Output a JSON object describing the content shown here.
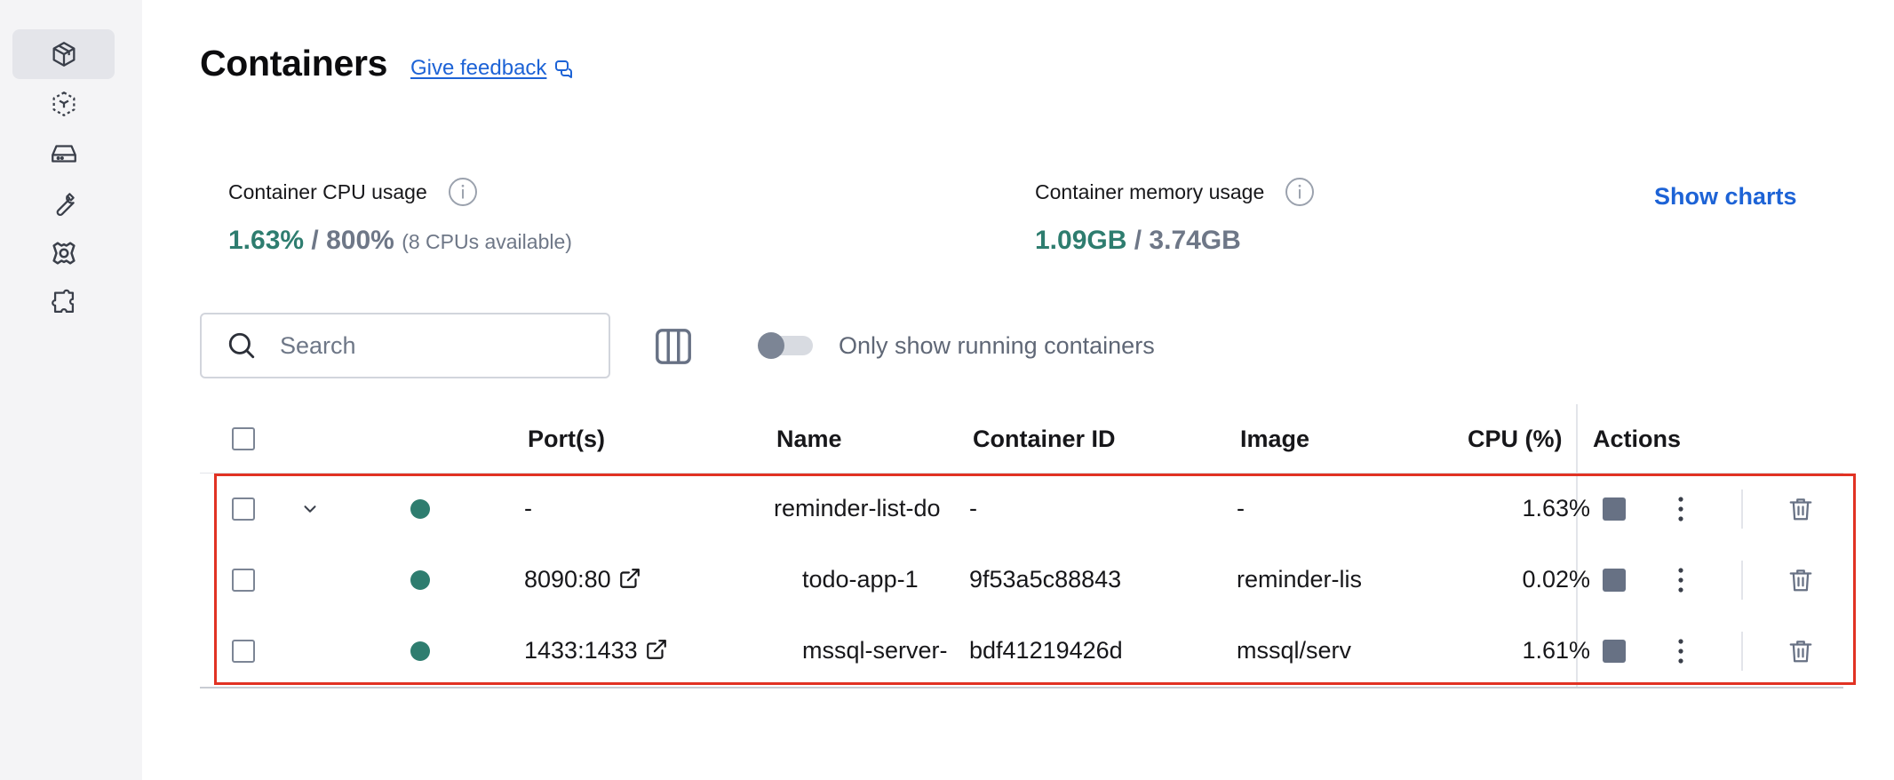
{
  "page": {
    "title": "Containers",
    "feedback_link": "Give feedback"
  },
  "sidebar": {
    "items": [
      {
        "icon": "containers-icon",
        "active": true
      },
      {
        "icon": "images-icon",
        "active": false
      },
      {
        "icon": "volumes-icon",
        "active": false
      },
      {
        "icon": "builds-icon",
        "active": false
      },
      {
        "icon": "scout-icon",
        "active": false
      },
      {
        "icon": "extensions-icon",
        "active": false
      }
    ]
  },
  "stats": {
    "cpu": {
      "label": "Container CPU usage",
      "used": "1.63%",
      "separator": "/",
      "total": "800%",
      "note": "(8 CPUs available)"
    },
    "memory": {
      "label": "Container memory usage",
      "used": "1.09GB",
      "separator": "/",
      "total": "3.74GB"
    },
    "show_charts": "Show charts"
  },
  "toolbar": {
    "search_placeholder": "Search",
    "toggle_label": "Only show running containers",
    "toggle_on": false
  },
  "table": {
    "columns": {
      "ports": "Port(s)",
      "name": "Name",
      "container_id": "Container ID",
      "image": "Image",
      "cpu": "CPU (%)",
      "actions": "Actions"
    },
    "rows": [
      {
        "group": true,
        "ports": "-",
        "name": "reminder-list-do",
        "container_id": "-",
        "image": "-",
        "cpu": "1.63%",
        "status": "running"
      },
      {
        "group": false,
        "ports": "8090:80",
        "name": "todo-app-1",
        "container_id": "9f53a5c88843",
        "image": "reminder-lis",
        "cpu": "0.02%",
        "status": "running"
      },
      {
        "group": false,
        "ports": "1433:1433",
        "name": "mssql-server-",
        "container_id": "bdf41219426d",
        "image": "mssql/serv",
        "cpu": "1.61%",
        "status": "running"
      }
    ]
  },
  "colors": {
    "accent": "#1d63d6",
    "running": "#2e7d6f",
    "highlight": "#e13223"
  }
}
